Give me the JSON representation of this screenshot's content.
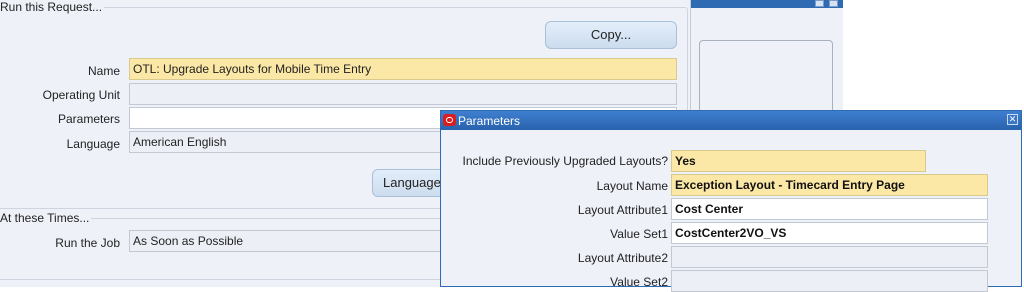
{
  "request": {
    "section_title": "Run this Request...",
    "copy_button": "Copy...",
    "name_label": "Name",
    "name_value": "OTL: Upgrade Layouts for Mobile Time Entry",
    "operating_unit_label": "Operating Unit",
    "operating_unit_value": "",
    "parameters_label": "Parameters",
    "parameters_value": "",
    "language_label": "Language",
    "language_value": "American English",
    "language_button": "Language"
  },
  "times": {
    "section_title": "At these Times...",
    "run_job_label": "Run the Job",
    "run_job_value": "As Soon as Possible"
  },
  "parameters_dialog": {
    "title": "Parameters",
    "close_icon": "close-icon",
    "fields": [
      {
        "label": "Include Previously Upgraded Layouts?",
        "value": "Yes"
      },
      {
        "label": "Layout Name",
        "value": "Exception Layout - Timecard Entry Page"
      },
      {
        "label": "Layout Attribute1",
        "value": "Cost Center"
      },
      {
        "label": "Value Set1",
        "value": "CostCenter2VO_VS"
      },
      {
        "label": "Layout Attribute2",
        "value": ""
      },
      {
        "label": "Value Set2",
        "value": ""
      }
    ]
  },
  "colors": {
    "required_field": "#fce8a6",
    "title_bar": "#2e6bb3",
    "form_background": "#eef1f8"
  }
}
